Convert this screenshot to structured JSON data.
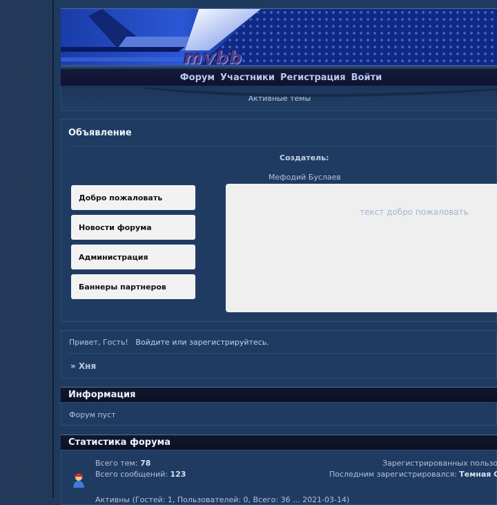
{
  "header": {
    "logo_text": "mybb",
    "nav": [
      "Форум",
      "Участники",
      "Регистрация",
      "Войти"
    ],
    "subnav_link": "Активные темы"
  },
  "announcement": {
    "title": "Объявление",
    "creator_label": "Создатель:",
    "creator_name": "Мефодий Буслаев",
    "menu": [
      "Добро пожаловать",
      "Новости форума",
      "Администрация",
      "Баннеры партнеров"
    ],
    "panel_text": "текст добро пожаловать"
  },
  "greeting": {
    "prefix": "Привет, Гость!",
    "login_link": "Войдите или зарегистрируйтесь.",
    "breadcrumb": "» Хня"
  },
  "info": {
    "title": "Информация",
    "text": "Форум пуст"
  },
  "stats": {
    "title": "Статистика форума",
    "topics_label": "Всего тем:",
    "topics_value": "78",
    "posts_label": "Всего сообщений:",
    "posts_value": "123",
    "registered_label": "Зарегистрированных пользо",
    "last_registered_label": "Последним зарегистрировался:",
    "last_registered_value": "Темная С",
    "bottom_line": "Активны (Гостей: 1, Пользователей: 0, Всего: 36 ... 2021-03-14)"
  },
  "colors": {
    "page_bg": "#21395a",
    "panel_bg": "#203b61",
    "nav_bg": "#0f1230",
    "accent_text": "#b8c9ec"
  }
}
